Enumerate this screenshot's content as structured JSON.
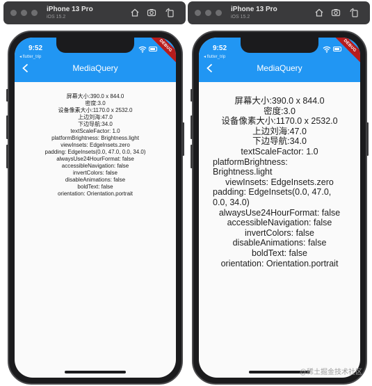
{
  "simulators": [
    {
      "device": "iPhone 13 Pro",
      "os": "iOS 15.2",
      "status_time": "9:52",
      "back_app": "◂ flutter_trip",
      "debug_label": "DEBUG",
      "title": "MediaQuery",
      "lines": [
        "屏幕大小:390.0 x 844.0",
        "密度:3.0",
        "设备像素大小:1170.0 x 2532.0",
        "上边刘海:47.0",
        "下边导航:34.0",
        "textScaleFactor: 1.0",
        "platformBrightness: Brightness.light",
        "viewInsets: EdgeInsets.zero",
        "padding: EdgeInsets(0.0, 47.0, 0.0, 34.0)",
        "alwaysUse24HourFormat: false",
        "accessibleNavigation: false",
        "invertColors: false",
        "disableAnimations: false",
        "boldText: false",
        "orientation: Orientation.portrait"
      ]
    },
    {
      "device": "iPhone 13 Pro",
      "os": "iOS 15.2",
      "status_time": "9:52",
      "back_app": "◂ flutter_trip",
      "debug_label": "DEBUG",
      "title": "MediaQuery",
      "lines": [
        "屏幕大小:390.0 x 844.0",
        "密度:3.0",
        "设备像素大小:1170.0 x 2532.0",
        "上边刘海:47.0",
        "下边导航:34.0",
        "textScaleFactor: 1.0",
        "platformBrightness: Brightness.light",
        "viewInsets: EdgeInsets.zero",
        "padding: EdgeInsets(0.0, 47.0, 0.0, 34.0)",
        "alwaysUse24HourFormat: false",
        "accessibleNavigation: false",
        "invertColors: false",
        "disableAnimations: false",
        "boldText: false",
        "orientation: Orientation.portrait"
      ]
    }
  ],
  "watermark": "@稀土掘金技术社区",
  "colors": {
    "appbar": "#2196f3",
    "debug_banner": "#b71c1c",
    "screen_bg": "#fafafa"
  }
}
